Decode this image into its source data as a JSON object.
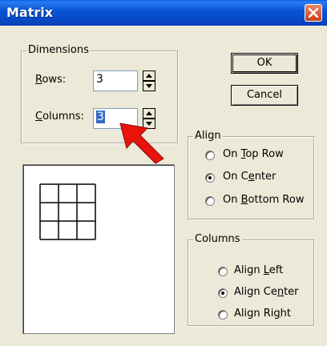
{
  "window": {
    "title": "Matrix",
    "close_icon": "close-icon"
  },
  "dimensions": {
    "group_label": "Dimensions",
    "rows_label": "Rows:",
    "rows_value": "3",
    "columns_label": "Columns:",
    "columns_value": "3"
  },
  "buttons": {
    "ok": "OK",
    "cancel": "Cancel"
  },
  "align": {
    "group_label": "Align",
    "options": [
      {
        "label": "On Top Row",
        "checked": false
      },
      {
        "label": "On Center",
        "checked": true
      },
      {
        "label": "On Bottom Row",
        "checked": false
      }
    ]
  },
  "columns_align": {
    "group_label": "Columns",
    "options": [
      {
        "label": "Align Left",
        "checked": false
      },
      {
        "label": "Align Center",
        "checked": true
      },
      {
        "label": "Align Right",
        "checked": false
      }
    ]
  },
  "preview": {
    "matrix_rows": 3,
    "matrix_cols": 3
  },
  "colors": {
    "title_bar": "#0a55d6",
    "annotation_arrow": "#e8140c",
    "selection": "#316ac5"
  }
}
